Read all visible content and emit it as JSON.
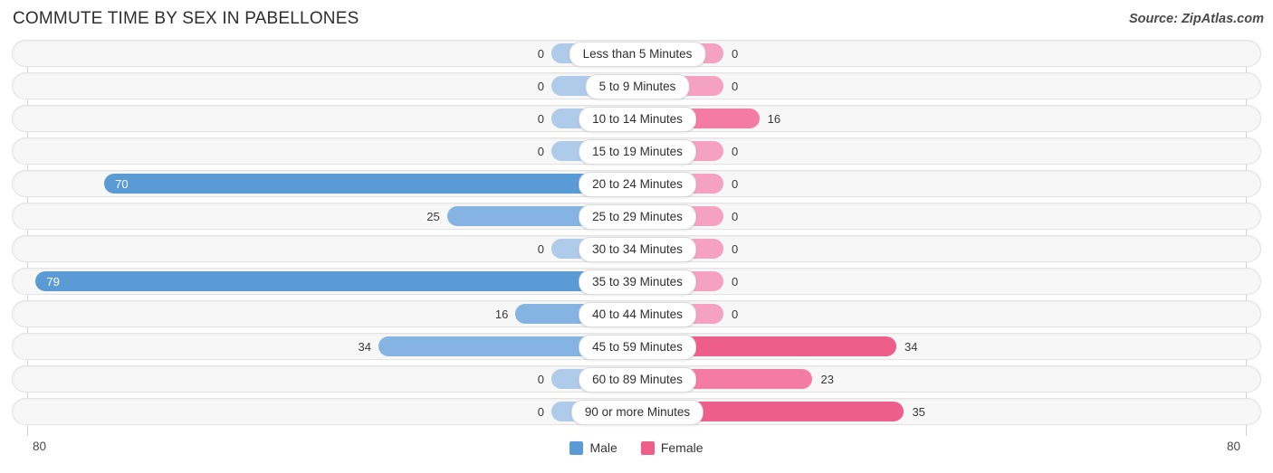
{
  "header": {
    "title": "COMMUTE TIME BY SEX IN PABELLONES",
    "source": "Source: ZipAtlas.com"
  },
  "axis": {
    "left_label": "80",
    "right_label": "80"
  },
  "legend": {
    "items": [
      {
        "label": "Male",
        "color": "#5B9BD5"
      },
      {
        "label": "Female",
        "color": "#EE5E8B"
      }
    ]
  },
  "colors": {
    "male_strong": "#5B9BD5",
    "male_mid": "#85B4E2",
    "male_zero": "#AFCBEA",
    "female_strong": "#EE5E8B",
    "female_mid": "#F47BA4",
    "female_zero": "#F4A2C0",
    "row_bg": "#f7f7f7",
    "row_border": "#e3e3e3",
    "grid": "#d0d0d0"
  },
  "chart_data": {
    "type": "bar",
    "title": "COMMUTE TIME BY SEX IN PABELLONES",
    "subtitle": "",
    "xlabel": "",
    "ylabel": "",
    "orientation": "horizontal-diverging",
    "axis_max": 80,
    "xlim": [
      -80,
      80
    ],
    "grid": true,
    "legend_position": "bottom-center",
    "categories": [
      "Less than 5 Minutes",
      "5 to 9 Minutes",
      "10 to 14 Minutes",
      "15 to 19 Minutes",
      "20 to 24 Minutes",
      "25 to 29 Minutes",
      "30 to 34 Minutes",
      "35 to 39 Minutes",
      "40 to 44 Minutes",
      "45 to 59 Minutes",
      "60 to 89 Minutes",
      "90 or more Minutes"
    ],
    "series": [
      {
        "name": "Male",
        "side": "left",
        "values": [
          0,
          0,
          0,
          0,
          70,
          25,
          0,
          79,
          16,
          34,
          0,
          0
        ],
        "labels": [
          "0",
          "0",
          "0",
          "0",
          "70",
          "25",
          "0",
          "79",
          "16",
          "34",
          "0",
          "0"
        ]
      },
      {
        "name": "Female",
        "side": "right",
        "values": [
          0,
          0,
          16,
          0,
          0,
          0,
          0,
          0,
          0,
          34,
          23,
          35
        ],
        "labels": [
          "0",
          "0",
          "16",
          "0",
          "0",
          "0",
          "0",
          "0",
          "0",
          "34",
          "23",
          "35"
        ]
      }
    ]
  }
}
